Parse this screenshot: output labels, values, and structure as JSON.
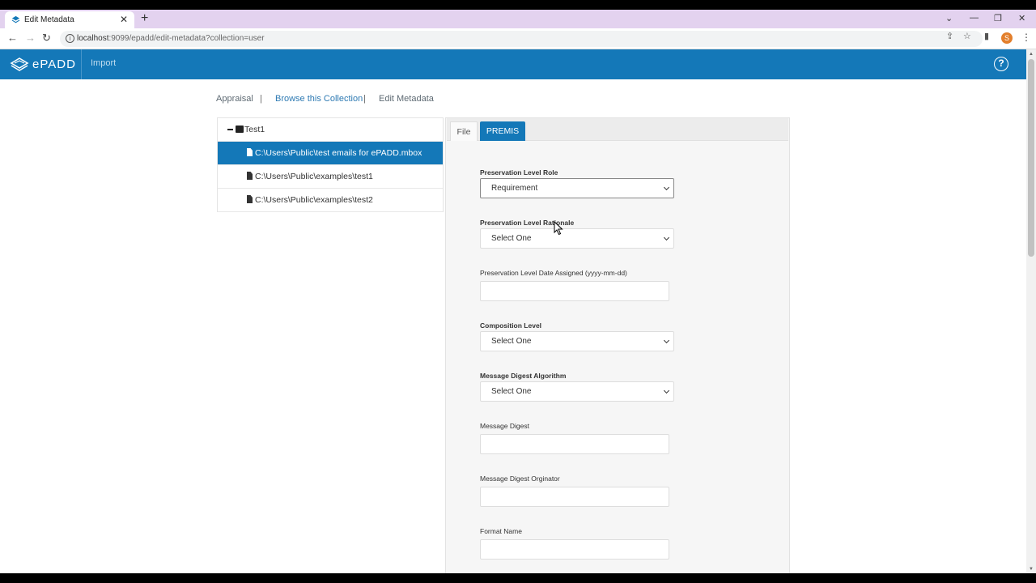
{
  "browser": {
    "tab_title": "Edit Metadata",
    "tab_close": "✕",
    "new_tab": "+",
    "url_host": "localhost",
    "url_rest": ":9099/epadd/edit-metadata?collection=user",
    "profile_initial": "S",
    "controls": {
      "dropdown": "⌄",
      "minimize": "—",
      "restore": "❐",
      "close": "✕"
    }
  },
  "header": {
    "logo_text": "ePADD",
    "import_label": "Import",
    "help_label": "?"
  },
  "breadcrumb": {
    "items": [
      "Appraisal",
      "Browse this Collection",
      "Edit Metadata"
    ],
    "separator": "|"
  },
  "tree": {
    "root_label": "Test1",
    "files": [
      "C:\\Users\\Public\\test emails for ePADD.mbox",
      "C:\\Users\\Public\\examples\\test1",
      "C:\\Users\\Public\\examples\\test2"
    ]
  },
  "editor": {
    "tabs": [
      "File",
      "PREMIS"
    ],
    "active_tab": "PREMIS",
    "fields": [
      {
        "label": "Preservation Level Role",
        "value": "Requirement"
      },
      {
        "label": "Preservation Level Rationale",
        "value": "Select One"
      },
      {
        "label": "Preservation Level Date Assigned (yyyy-mm-dd)",
        "value": ""
      },
      {
        "label": "Composition Level",
        "value": "Select One"
      },
      {
        "label": "Message Digest Algorithm",
        "value": "Select One"
      },
      {
        "label": "Message Digest",
        "value": ""
      },
      {
        "label": "Message Digest Orginator",
        "value": ""
      },
      {
        "label": "Format Name",
        "value": ""
      }
    ]
  },
  "colors": {
    "brand_blue": "#1478b8",
    "tab_strip": "#e3d2ef",
    "profile": "#e37f2c"
  }
}
